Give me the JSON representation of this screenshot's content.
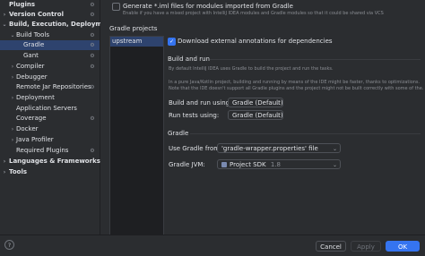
{
  "sidebar": {
    "items": [
      {
        "label": "Plugins",
        "arrow": "",
        "bold": true,
        "gear": true
      },
      {
        "label": "Version Control",
        "arrow": "›",
        "bold": true,
        "gear": true
      },
      {
        "label": "Build, Execution, Deployment",
        "arrow": "⌄",
        "bold": true,
        "gear": false
      },
      {
        "label": "Build Tools",
        "arrow": "⌄",
        "bold": false,
        "gear": true
      },
      {
        "label": "Gradle",
        "arrow": "",
        "bold": false,
        "gear": true,
        "selected": true
      },
      {
        "label": "Gant",
        "arrow": "",
        "bold": false,
        "gear": true
      },
      {
        "label": "Compiler",
        "arrow": "›",
        "bold": false,
        "gear": true
      },
      {
        "label": "Debugger",
        "arrow": "›",
        "bold": false,
        "gear": false
      },
      {
        "label": "Remote Jar Repositories",
        "arrow": "",
        "bold": false,
        "gear": true
      },
      {
        "label": "Deployment",
        "arrow": "›",
        "bold": false,
        "gear": false
      },
      {
        "label": "Application Servers",
        "arrow": "",
        "bold": false,
        "gear": false
      },
      {
        "label": "Coverage",
        "arrow": "",
        "bold": false,
        "gear": true
      },
      {
        "label": "Docker",
        "arrow": "›",
        "bold": false,
        "gear": false
      },
      {
        "label": "Java Profiler",
        "arrow": "›",
        "bold": false,
        "gear": false
      },
      {
        "label": "Required Plugins",
        "arrow": "",
        "bold": false,
        "gear": true
      },
      {
        "label": "Languages & Frameworks",
        "arrow": "›",
        "bold": true,
        "gear": false
      },
      {
        "label": "Tools",
        "arrow": "›",
        "bold": true,
        "gear": false
      }
    ]
  },
  "content": {
    "generate_iml_label": "Generate *.iml files for modules imported from Gradle",
    "generate_iml_help": "Enable if you have a mixed project with IntelliJ IDEA modules and Gradle modules so that it could be shared via VCS",
    "gradle_projects_label": "Gradle projects",
    "project_item": "upstream",
    "download_annotations_label": "Download external annotations for dependencies",
    "build_run_heading": "Build and run",
    "build_run_desc1": "By default IntelliJ IDEA uses Gradle to build the project and run the tasks.",
    "build_run_desc2": "In a pure Java/Kotlin project, building and running by means of the IDE might be faster, thanks to optimizations.",
    "build_run_desc3": "Note that the IDE doesn't support all Gradle plugins and the project might not be built correctly with some of the.",
    "build_run_using_label": "Build and run using:",
    "build_run_using_value": "Gradle (Default)",
    "run_tests_using_label": "Run tests using:",
    "run_tests_using_value": "Gradle (Default)",
    "gradle_heading": "Gradle",
    "use_gradle_from_label": "Use Gradle from:",
    "use_gradle_from_value": "'gradle-wrapper.properties' file",
    "gradle_jvm_label": "Gradle JVM:",
    "gradle_jvm_value": "Project SDK",
    "gradle_jvm_version": "1.8"
  },
  "footer": {
    "help_label": "?",
    "cancel_label": "Cancel",
    "apply_label": "Apply",
    "ok_label": "OK"
  }
}
